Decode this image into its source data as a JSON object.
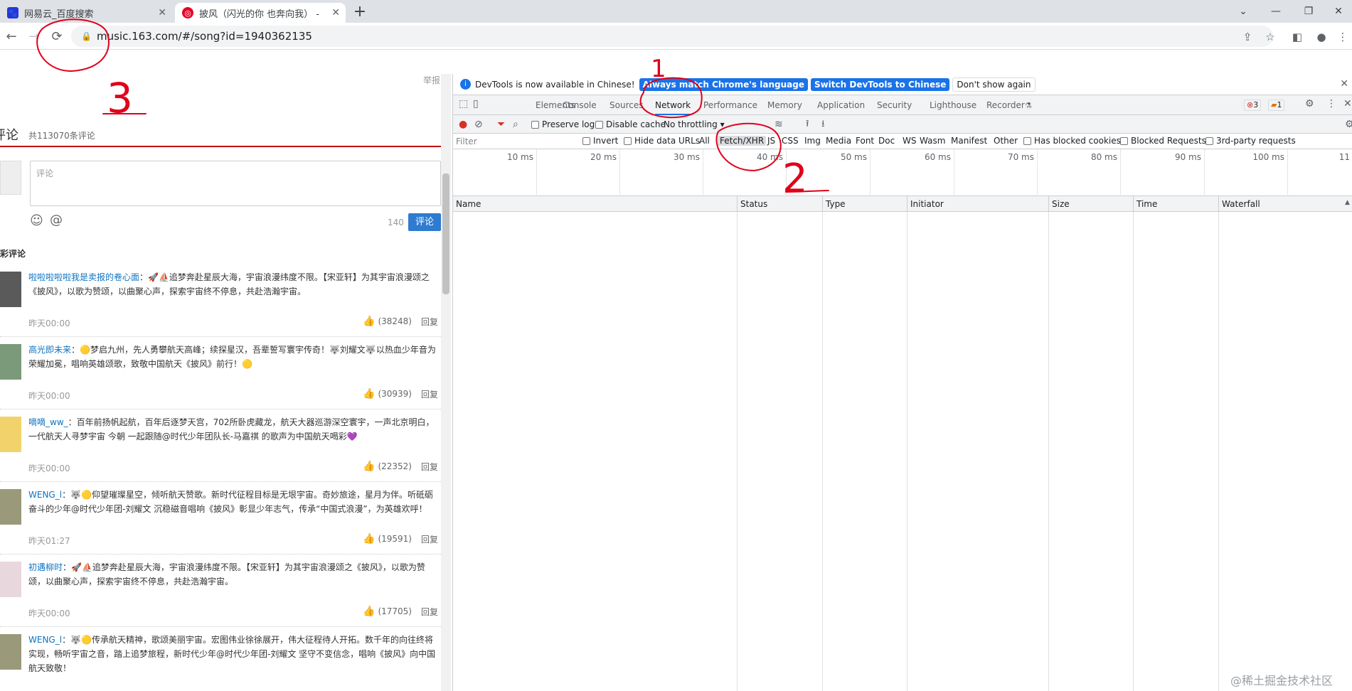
{
  "browser": {
    "tabs": [
      {
        "title": "网易云_百度搜索"
      },
      {
        "title": "披风（闪光的你 也奔向我） - 时"
      }
    ],
    "url": "music.163.com/#/song?id=1940362135"
  },
  "page": {
    "report": "举报",
    "comments_title": "评论",
    "comments_count": "共113070条评论",
    "input_placeholder": "评论",
    "char_count": "140",
    "submit_label": "评论",
    "hot_title": "精彩评论",
    "like_icon": "thumbs-up-icon",
    "reply_label": "回复",
    "comments": [
      {
        "user": "啦啦啦啦啦我是卖报的卷心面",
        "text": "：🚀⛵追梦奔赴星辰大海，宇宙浪漫纬度不限。【宋亚轩】为其宇宙浪漫颂之《披风》，以歌为赞颂，以曲聚心声，探索宇宙终不停息，共赴浩瀚宇宙。",
        "time": "昨天00:00",
        "likes": "(38248)"
      },
      {
        "user": "高光即未来",
        "text": "：🟡梦启九州，先人勇攀航天高峰；续探星汉，吾辈誓写寰宇传奇！🐺刘耀文🐺以热血少年音为荣耀加冕，唱响英雄颂歌，致敬中国航天《披风》前行！🟡",
        "time": "昨天00:00",
        "likes": "(30939)"
      },
      {
        "user": "嘀嘀_ww_",
        "text": "：百年前扬帆起航，百年后逐梦天宫，702所卧虎藏龙，航天大器巡游深空寰宇，一声北京明白，一代航天人寻梦宇宙 今朝 一起跟随@时代少年团队长-马嘉祺 的歌声为中国航天喝彩💜",
        "time": "昨天00:00",
        "likes": "(22352)"
      },
      {
        "user": "WENG_l",
        "text": "：🐺🟡仰望璀璨星空，倾听航天赞歌。新时代征程目标是无垠宇宙。奇妙旅途，星月为伴。听砥砺奋斗的少年@时代少年团-刘耀文 沉稳磁音唱响《披风》彰显少年志气，传承“中国式浪漫”，为英雄欢呼！",
        "time": "昨天01:27",
        "likes": "(19591)"
      },
      {
        "user": "初遇柳时",
        "text": "：🚀⛵追梦奔赴星辰大海，宇宙浪漫纬度不限。【宋亚轩】为其宇宙浪漫颂之《披风》，以歌为赞颂，以曲聚心声，探索宇宙终不停息，共赴浩瀚宇宙。",
        "time": "昨天00:00",
        "likes": "(17705)"
      },
      {
        "user": "WENG_l",
        "text": "：🐺🟡传承航天精神，歌颂美丽宇宙。宏图伟业徐徐展开，伟大征程待人开拓。数千年的向往终将实现，畅听宇宙之音，踏上追梦旅程，新时代少年@时代少年团-刘耀文 坚守不变信念，唱响《披风》向中国航天致敬！",
        "time": "",
        "likes": ""
      }
    ]
  },
  "devtools": {
    "info_text": "DevTools is now available in Chinese!",
    "btn_match": "Always match Chrome's language",
    "btn_switch": "Switch DevTools to Chinese",
    "btn_dont": "Don't show again",
    "tabs": [
      "Elements",
      "Console",
      "Sources",
      "Network",
      "Performance",
      "Memory",
      "Application",
      "Security",
      "Lighthouse",
      "Recorder"
    ],
    "errors": "3",
    "warnings": "1",
    "preserve_log": "Preserve log",
    "disable_cache": "Disable cache",
    "throttling": "No throttling",
    "filter_placeholder": "Filter",
    "invert": "Invert",
    "hide_data_urls": "Hide data URLs",
    "types": [
      "All",
      "Fetch/XHR",
      "JS",
      "CSS",
      "Img",
      "Media",
      "Font",
      "Doc",
      "WS",
      "Wasm",
      "Manifest",
      "Other"
    ],
    "blocked_cookies": "Has blocked cookies",
    "blocked_requests": "Blocked Requests",
    "third_party": "3rd-party requests",
    "ticks": [
      "10 ms",
      "20 ms",
      "30 ms",
      "40 ms",
      "50 ms",
      "60 ms",
      "70 ms",
      "80 ms",
      "90 ms",
      "100 ms",
      "11"
    ],
    "columns": [
      "Name",
      "Status",
      "Type",
      "Initiator",
      "Size",
      "Time",
      "Waterfall"
    ]
  },
  "annotations": [
    "1",
    "2",
    "3"
  ],
  "watermark": "@稀土掘金技术社区",
  "colors": {
    "accent": "#1a73e8",
    "netease_red": "#c20c0c",
    "annotation": "#e0001b"
  }
}
